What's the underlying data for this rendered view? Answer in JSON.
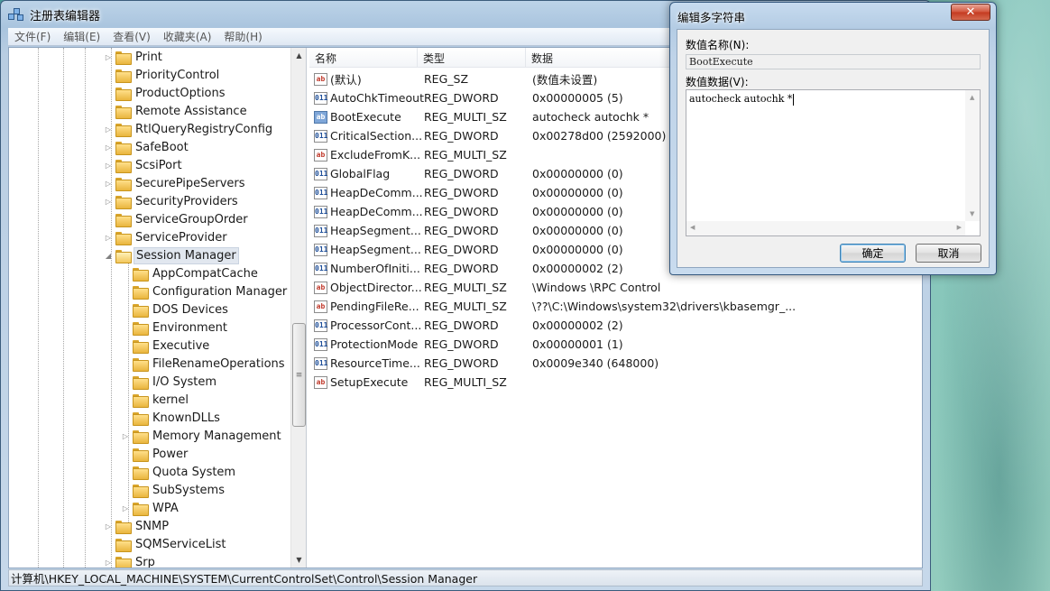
{
  "window": {
    "title": "注册表编辑器",
    "menu": [
      "文件(F)",
      "编辑(E)",
      "查看(V)",
      "收藏夹(A)",
      "帮助(H)"
    ]
  },
  "tree": {
    "items": [
      {
        "label": "Print",
        "expandable": true
      },
      {
        "label": "PriorityControl",
        "expandable": false
      },
      {
        "label": "ProductOptions",
        "expandable": false
      },
      {
        "label": "Remote Assistance",
        "expandable": false
      },
      {
        "label": "RtlQueryRegistryConfig",
        "expandable": true
      },
      {
        "label": "SafeBoot",
        "expandable": true
      },
      {
        "label": "ScsiPort",
        "expandable": true
      },
      {
        "label": "SecurePipeServers",
        "expandable": true
      },
      {
        "label": "SecurityProviders",
        "expandable": true
      },
      {
        "label": "ServiceGroupOrder",
        "expandable": false
      },
      {
        "label": "ServiceProvider",
        "expandable": true
      },
      {
        "label": "Session Manager",
        "expandable": true,
        "expanded": true,
        "selected": true
      },
      {
        "label": "AppCompatCache",
        "child": true
      },
      {
        "label": "Configuration Manager",
        "child": true
      },
      {
        "label": "DOS Devices",
        "child": true
      },
      {
        "label": "Environment",
        "child": true
      },
      {
        "label": "Executive",
        "child": true
      },
      {
        "label": "FileRenameOperations",
        "child": true
      },
      {
        "label": "I/O System",
        "child": true
      },
      {
        "label": "kernel",
        "child": true
      },
      {
        "label": "KnownDLLs",
        "child": true
      },
      {
        "label": "Memory Management",
        "child": true,
        "expandable": true
      },
      {
        "label": "Power",
        "child": true
      },
      {
        "label": "Quota System",
        "child": true
      },
      {
        "label": "SubSystems",
        "child": true
      },
      {
        "label": "WPA",
        "child": true,
        "expandable": true
      },
      {
        "label": "SNMP",
        "expandable": true
      },
      {
        "label": "SQMServiceList",
        "expandable": false
      },
      {
        "label": "Srp",
        "expandable": true
      }
    ]
  },
  "list": {
    "columns": [
      "名称",
      "类型",
      "数据"
    ],
    "rows": [
      {
        "icon": "sz",
        "name": "(默认)",
        "type": "REG_SZ",
        "data": "(数值未设置)"
      },
      {
        "icon": "dword",
        "name": "AutoChkTimeout",
        "type": "REG_DWORD",
        "data": "0x00000005 (5)"
      },
      {
        "icon": "multi",
        "name": "BootExecute",
        "type": "REG_MULTI_SZ",
        "data": "autocheck autochk *"
      },
      {
        "icon": "dword",
        "name": "CriticalSection...",
        "type": "REG_DWORD",
        "data": "0x00278d00 (2592000)"
      },
      {
        "icon": "sz",
        "name": "ExcludeFromK...",
        "type": "REG_MULTI_SZ",
        "data": ""
      },
      {
        "icon": "dword",
        "name": "GlobalFlag",
        "type": "REG_DWORD",
        "data": "0x00000000 (0)"
      },
      {
        "icon": "dword",
        "name": "HeapDeComm...",
        "type": "REG_DWORD",
        "data": "0x00000000 (0)"
      },
      {
        "icon": "dword",
        "name": "HeapDeComm...",
        "type": "REG_DWORD",
        "data": "0x00000000 (0)"
      },
      {
        "icon": "dword",
        "name": "HeapSegment...",
        "type": "REG_DWORD",
        "data": "0x00000000 (0)"
      },
      {
        "icon": "dword",
        "name": "HeapSegment...",
        "type": "REG_DWORD",
        "data": "0x00000000 (0)"
      },
      {
        "icon": "dword",
        "name": "NumberOfIniti...",
        "type": "REG_DWORD",
        "data": "0x00000002 (2)"
      },
      {
        "icon": "sz",
        "name": "ObjectDirector...",
        "type": "REG_MULTI_SZ",
        "data": "\\Windows \\RPC Control"
      },
      {
        "icon": "sz",
        "name": "PendingFileRe...",
        "type": "REG_MULTI_SZ",
        "data": "\\??\\C:\\Windows\\system32\\drivers\\kbasemgr_..."
      },
      {
        "icon": "dword",
        "name": "ProcessorCont...",
        "type": "REG_DWORD",
        "data": "0x00000002 (2)"
      },
      {
        "icon": "dword",
        "name": "ProtectionMode",
        "type": "REG_DWORD",
        "data": "0x00000001 (1)"
      },
      {
        "icon": "dword",
        "name": "ResourceTime...",
        "type": "REG_DWORD",
        "data": "0x0009e340 (648000)"
      },
      {
        "icon": "sz",
        "name": "SetupExecute",
        "type": "REG_MULTI_SZ",
        "data": ""
      }
    ]
  },
  "status": {
    "path": "计算机\\HKEY_LOCAL_MACHINE\\SYSTEM\\CurrentControlSet\\Control\\Session Manager"
  },
  "dialog": {
    "title": "编辑多字符串",
    "name_label": "数值名称(N):",
    "name_value": "BootExecute",
    "data_label": "数值数据(V):",
    "data_value": "autocheck autochk *",
    "ok_label": "确定",
    "cancel_label": "取消",
    "close_label": "✕"
  }
}
